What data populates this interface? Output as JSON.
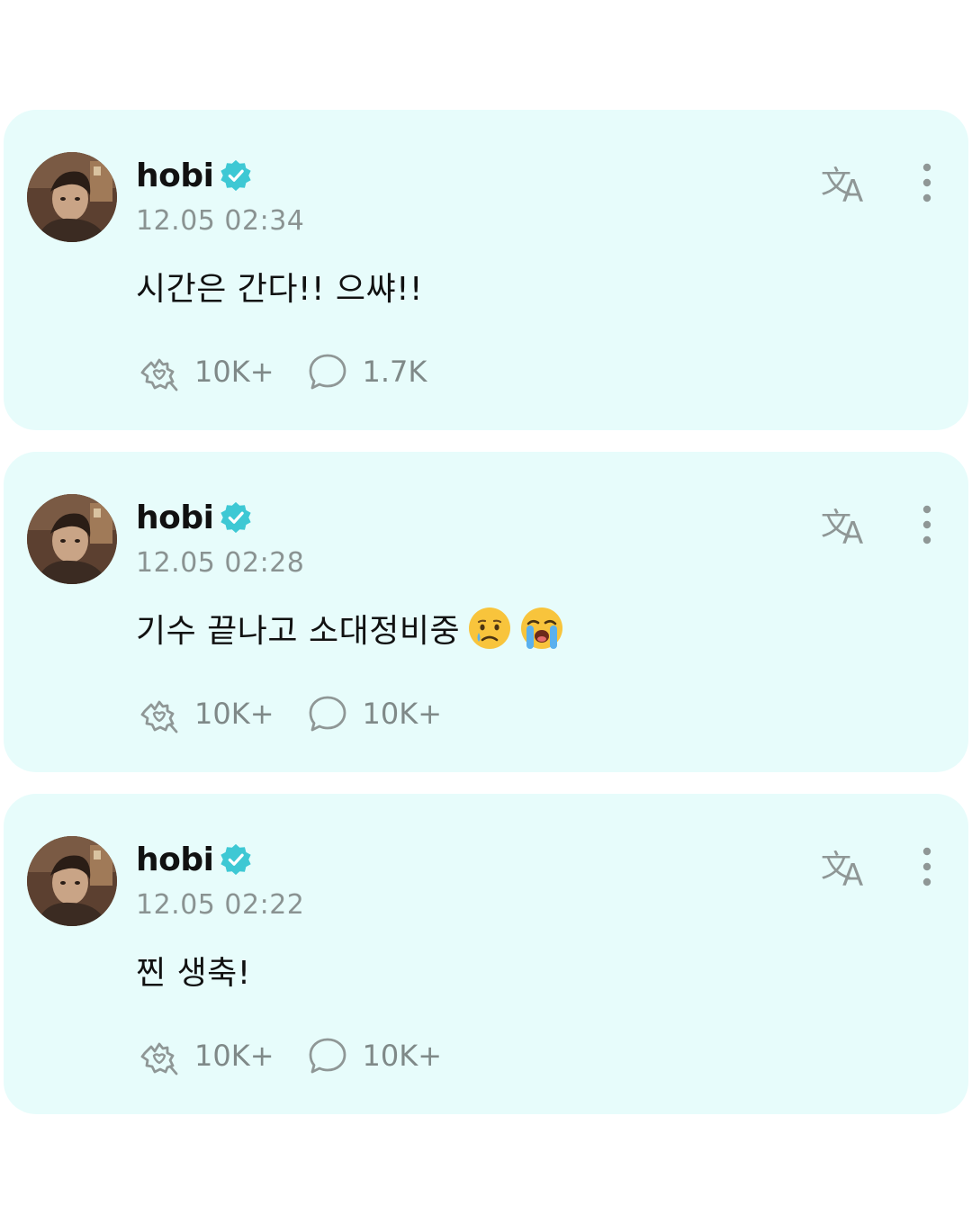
{
  "colors": {
    "card_background": "#e7fcfb",
    "verified_badge": "#3ec8d4",
    "username": "#111111",
    "timestamp": "#8a9392",
    "icon_gray": "#8f9796"
  },
  "posts": [
    {
      "username": "hobi",
      "verified": true,
      "timestamp": "12.05 02:34",
      "message": "시간은 간다!! 으쌰!!",
      "emojis": [],
      "reactions_count": "10K+",
      "comments_count": "1.7K"
    },
    {
      "username": "hobi",
      "verified": true,
      "timestamp": "12.05 02:28",
      "message": "기수 끝나고 소대정비중",
      "emojis": [
        "crying-face-emoji",
        "loudly-crying-face-emoji"
      ],
      "reactions_count": "10K+",
      "comments_count": "10K+"
    },
    {
      "username": "hobi",
      "verified": true,
      "timestamp": "12.05 02:22",
      "message": "찐 생축!",
      "emojis": [],
      "reactions_count": "10K+",
      "comments_count": "10K+"
    }
  ],
  "icons": {
    "avatar": "profile-photo",
    "verified": "verified-badge-icon",
    "translate": "translate-icon",
    "more": "more-vertical-icon",
    "reaction": "reaction-icon",
    "comment": "comment-icon"
  }
}
